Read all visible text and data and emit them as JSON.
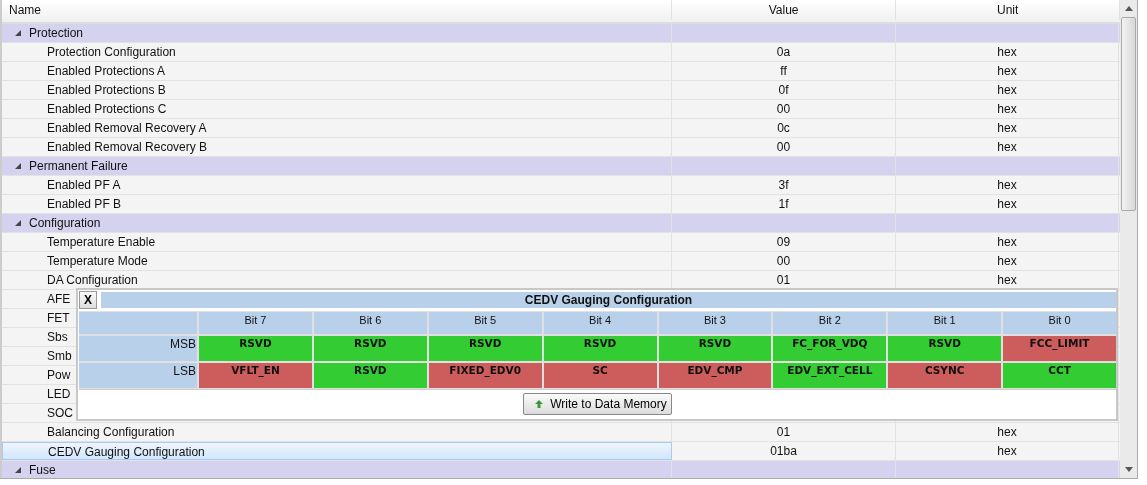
{
  "columns": [
    "Name",
    "Value",
    "Unit"
  ],
  "groups": [
    {
      "name": "Protection",
      "expanded": true,
      "children": [
        {
          "name": "Protection Configuration",
          "value": "0a",
          "unit": "hex",
          "selected": false
        },
        {
          "name": "Enabled Protections A",
          "value": "ff",
          "unit": "hex",
          "selected": false
        },
        {
          "name": "Enabled Protections B",
          "value": "0f",
          "unit": "hex",
          "selected": false
        },
        {
          "name": "Enabled Protections C",
          "value": "00",
          "unit": "hex",
          "selected": false
        },
        {
          "name": "Enabled Removal Recovery A",
          "value": "0c",
          "unit": "hex",
          "selected": false
        },
        {
          "name": "Enabled Removal Recovery B",
          "value": "00",
          "unit": "hex",
          "selected": false
        }
      ]
    },
    {
      "name": "Permanent Failure",
      "expanded": true,
      "children": [
        {
          "name": "Enabled PF A",
          "value": "3f",
          "unit": "hex",
          "selected": false
        },
        {
          "name": "Enabled PF B",
          "value": "1f",
          "unit": "hex",
          "selected": false
        }
      ]
    },
    {
      "name": "Configuration",
      "expanded": true,
      "children": [
        {
          "name": "Temperature Enable",
          "value": "09",
          "unit": "hex",
          "selected": false
        },
        {
          "name": "Temperature Mode",
          "value": "00",
          "unit": "hex",
          "selected": false
        },
        {
          "name": "DA Configuration",
          "value": "01",
          "unit": "hex",
          "selected": false
        },
        {
          "name": "AFE",
          "selected": false
        },
        {
          "name": "FET",
          "selected": false
        },
        {
          "name": "Sbs",
          "selected": false
        },
        {
          "name": "Smb",
          "selected": false
        },
        {
          "name": "Pow",
          "selected": false
        },
        {
          "name": "LED",
          "selected": false
        },
        {
          "name": "SOC",
          "selected": false
        },
        {
          "name": "Balancing Configuration",
          "value": "01",
          "unit": "hex",
          "selected": false
        },
        {
          "name": "CEDV Gauging Configuration",
          "value": "01ba",
          "unit": "hex",
          "selected": true
        }
      ]
    },
    {
      "name": "Fuse",
      "expanded": true
    }
  ],
  "popup": {
    "close": "X",
    "title": "CEDV Gauging Configuration",
    "columns": [
      "Bit 7",
      "Bit 6",
      "Bit 5",
      "Bit 4",
      "Bit 3",
      "Bit 2",
      "Bit 1",
      "Bit 0"
    ],
    "rows": [
      {
        "label": "MSB",
        "bits": [
          {
            "name": "RSVD",
            "color": "#33cc33"
          },
          {
            "name": "RSVD",
            "color": "#33cc33"
          },
          {
            "name": "RSVD",
            "color": "#33cc33"
          },
          {
            "name": "RSVD",
            "color": "#33cc33"
          },
          {
            "name": "RSVD",
            "color": "#33cc33"
          },
          {
            "name": "FC_FOR_VDQ",
            "color": "#33cc33"
          },
          {
            "name": "RSVD",
            "color": "#33cc33"
          },
          {
            "name": "FCC_LIMIT",
            "color": "#cd5c5c"
          }
        ]
      },
      {
        "label": "LSB",
        "bits": [
          {
            "name": "VFLT_EN",
            "color": "#cd5c5c"
          },
          {
            "name": "RSVD",
            "color": "#33cc33"
          },
          {
            "name": "FIXED_EDV0",
            "color": "#cd5c5c"
          },
          {
            "name": "SC",
            "color": "#cd5c5c"
          },
          {
            "name": "EDV_CMP",
            "color": "#cd5c5c"
          },
          {
            "name": "EDV_EXT_CELL",
            "color": "#33cc33"
          },
          {
            "name": "CSYNC",
            "color": "#cd5c5c"
          },
          {
            "name": "CCT",
            "color": "#33cc33"
          }
        ]
      }
    ],
    "button": "Write to Data Memory"
  }
}
